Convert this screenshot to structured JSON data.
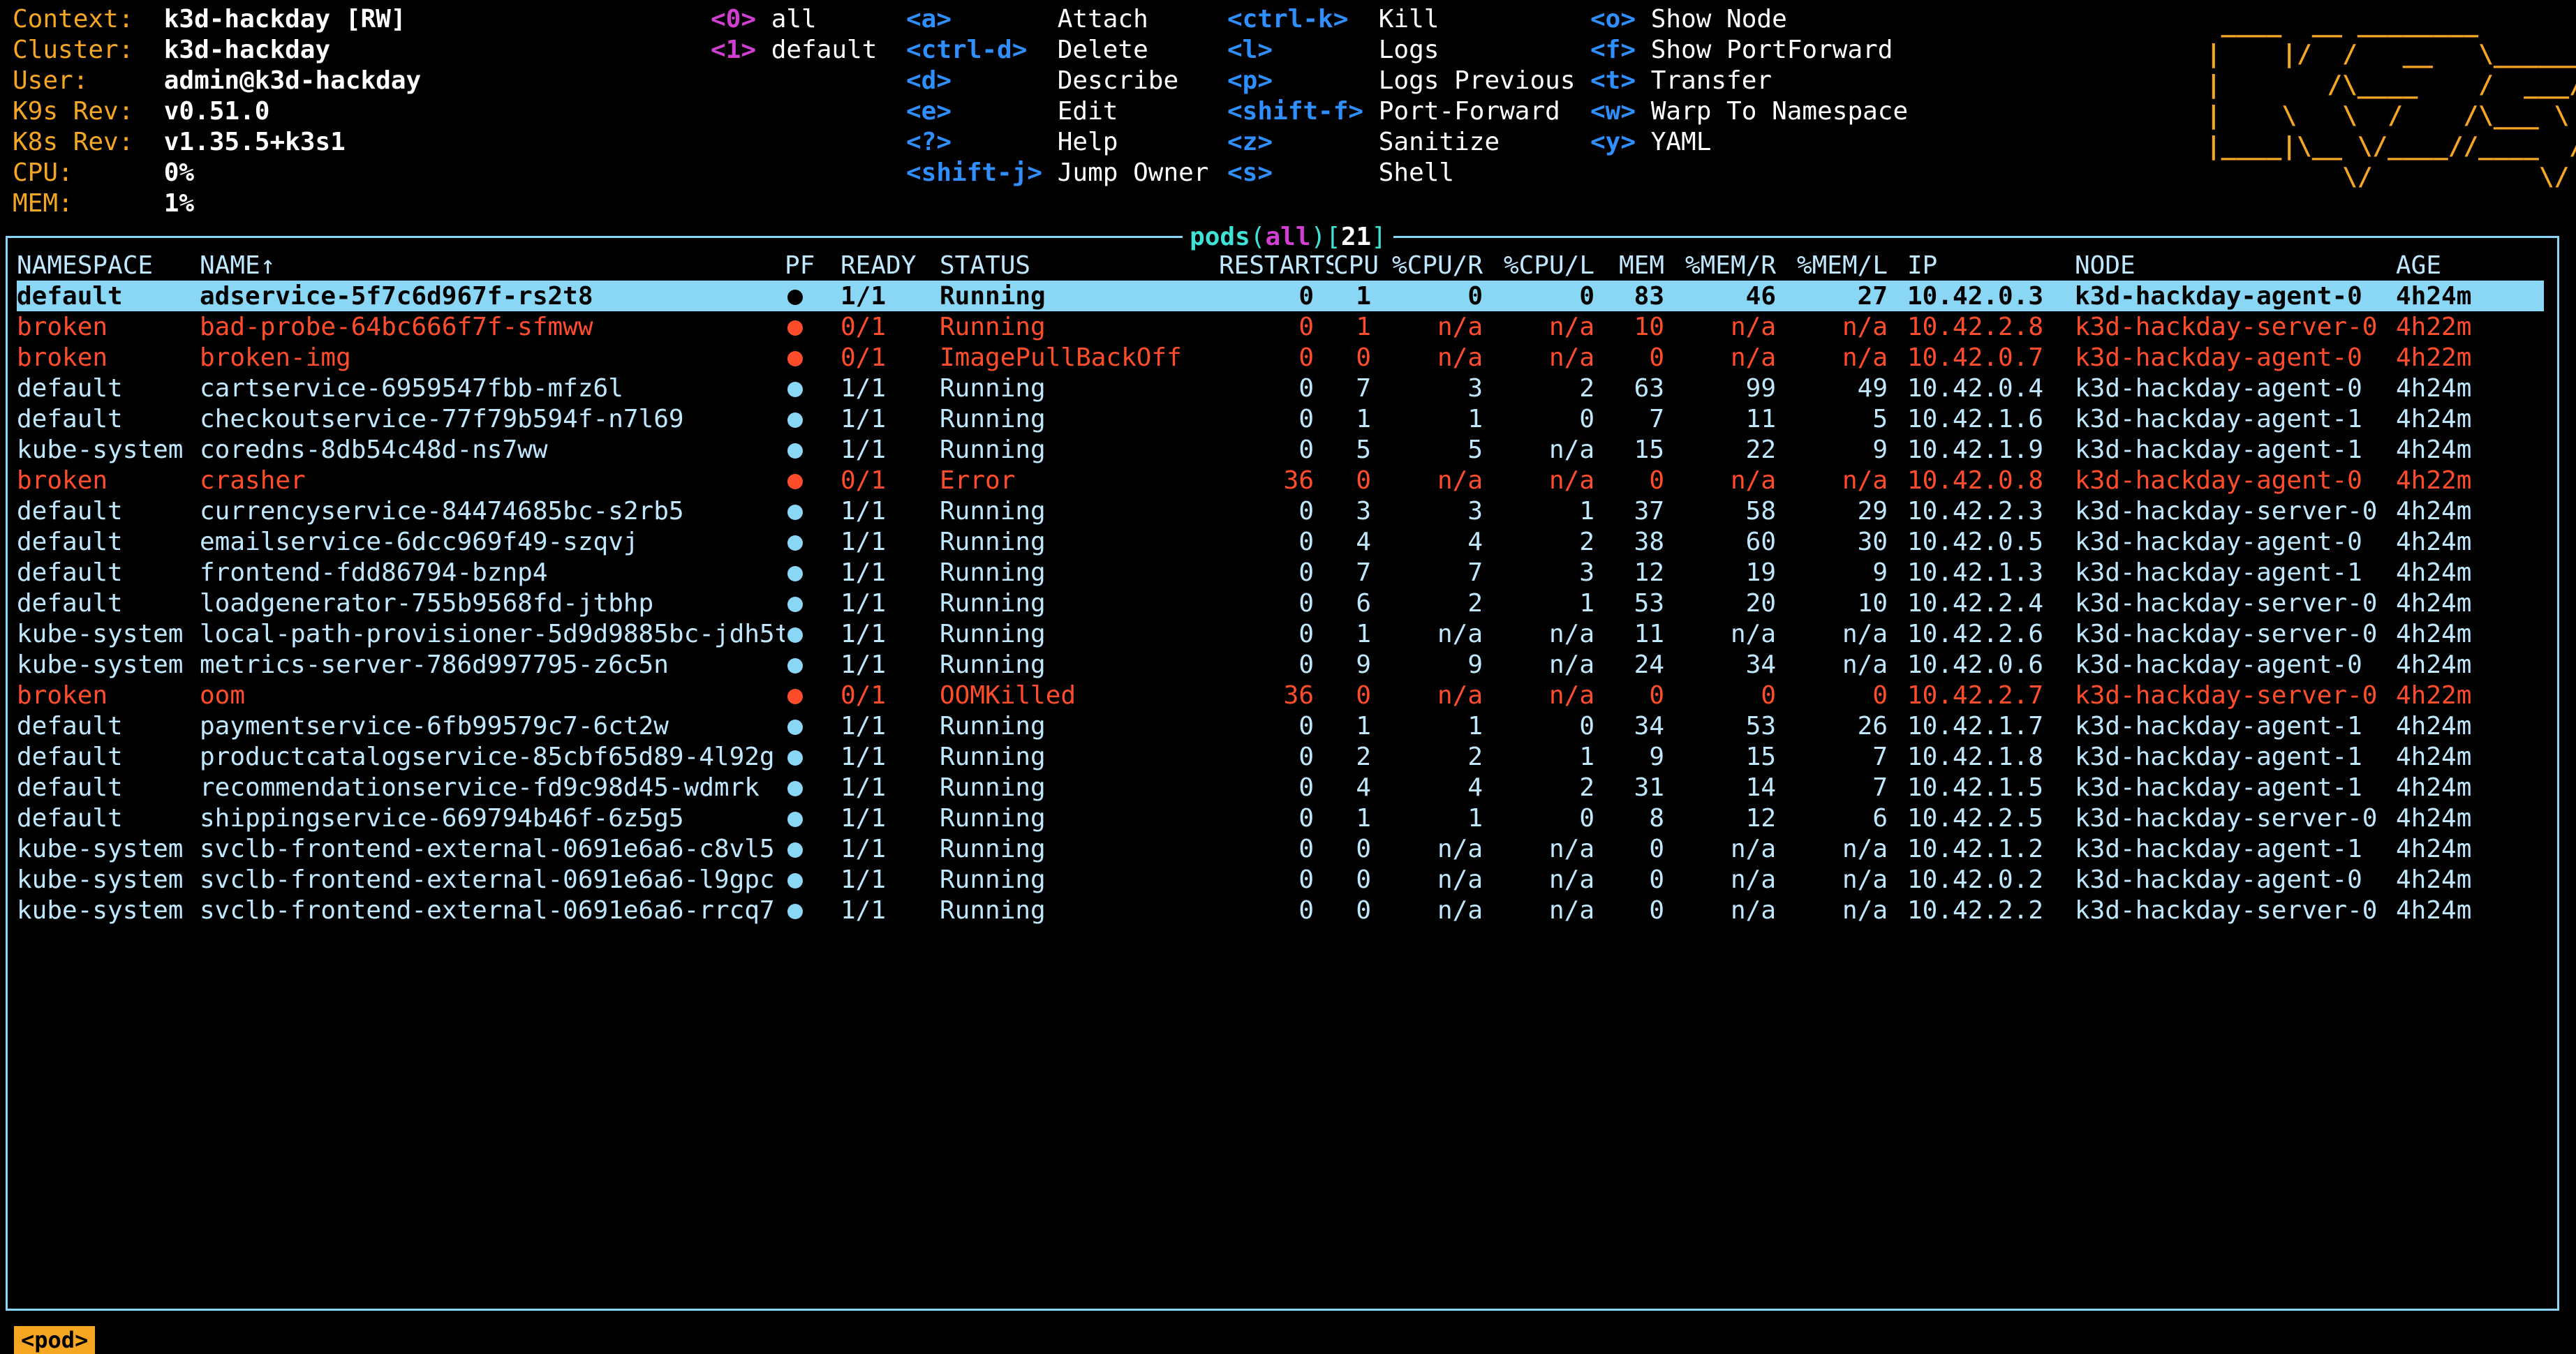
{
  "context": {
    "rows": [
      {
        "key": "Context:",
        "val": "k3d-hackday [RW]"
      },
      {
        "key": "Cluster:",
        "val": "k3d-hackday"
      },
      {
        "key": "User:",
        "val": "admin@k3d-hackday"
      },
      {
        "key": "K9s Rev:",
        "val": "v0.51.0"
      },
      {
        "key": "K8s Rev:",
        "val": "v1.35.5+k3s1"
      },
      {
        "key": "CPU:",
        "val": "0%"
      },
      {
        "key": "MEM:",
        "val": "1%"
      }
    ]
  },
  "namespaces": [
    {
      "key": "<0>",
      "val": "all"
    },
    {
      "key": "<1>",
      "val": "default"
    }
  ],
  "hotkeys": {
    "col1": [
      {
        "key": "<a>",
        "val": "Attach"
      },
      {
        "key": "<ctrl-d>",
        "val": "Delete"
      },
      {
        "key": "<d>",
        "val": "Describe"
      },
      {
        "key": "<e>",
        "val": "Edit"
      },
      {
        "key": "<?>",
        "val": "Help"
      },
      {
        "key": "<shift-j>",
        "val": "Jump Owner"
      }
    ],
    "col2": [
      {
        "key": "<ctrl-k>",
        "val": "Kill"
      },
      {
        "key": "<l>",
        "val": "Logs"
      },
      {
        "key": "<p>",
        "val": "Logs Previous"
      },
      {
        "key": "<shift-f>",
        "val": "Port-Forward"
      },
      {
        "key": "<z>",
        "val": "Sanitize"
      },
      {
        "key": "<s>",
        "val": "Shell"
      }
    ],
    "col3": [
      {
        "key": "<o>",
        "val": "Show Node"
      },
      {
        "key": "<f>",
        "val": "Show PortForward"
      },
      {
        "key": "<t>",
        "val": "Transfer"
      },
      {
        "key": "<w>",
        "val": "Warp To Namespace"
      },
      {
        "key": "<y>",
        "val": "YAML"
      }
    ]
  },
  "logo": " ____  __ ________        \n|    |/  /   __   \\______ \n|       /\\____    /  ___/ \n|    \\   \\  /    /\\___ \\  \n|____|\\__ \\/____//____  / \n         \\/           \\/  ",
  "title": {
    "resource": "pods",
    "filter": "all",
    "count": "21"
  },
  "columns": [
    "NAMESPACE",
    "NAME↑",
    "PF",
    "READY",
    "STATUS",
    "RESTARTS",
    "CPU",
    "%CPU/R",
    "%CPU/L",
    "MEM",
    "%MEM/R",
    "%MEM/L",
    "IP",
    "NODE",
    "AGE"
  ],
  "pods": [
    {
      "state": "selected",
      "ns": "default",
      "name": "adservice-5f7c6d967f-rs2t8",
      "ready": "1/1",
      "status": "Running",
      "restarts": "0",
      "cpu": "1",
      "cpur": "0",
      "cpul": "0",
      "mem": "83",
      "memr": "46",
      "meml": "27",
      "ip": "10.42.0.3",
      "node": "k3d-hackday-agent-0",
      "age": "4h24m"
    },
    {
      "state": "broken",
      "ns": "broken",
      "name": "bad-probe-64bc666f7f-sfmww",
      "ready": "0/1",
      "status": "Running",
      "restarts": "0",
      "cpu": "1",
      "cpur": "n/a",
      "cpul": "n/a",
      "mem": "10",
      "memr": "n/a",
      "meml": "n/a",
      "ip": "10.42.2.8",
      "node": "k3d-hackday-server-0",
      "age": "4h22m"
    },
    {
      "state": "broken",
      "ns": "broken",
      "name": "broken-img",
      "ready": "0/1",
      "status": "ImagePullBackOff",
      "restarts": "0",
      "cpu": "0",
      "cpur": "n/a",
      "cpul": "n/a",
      "mem": "0",
      "memr": "n/a",
      "meml": "n/a",
      "ip": "10.42.0.7",
      "node": "k3d-hackday-agent-0",
      "age": "4h22m"
    },
    {
      "state": "normal",
      "ns": "default",
      "name": "cartservice-6959547fbb-mfz6l",
      "ready": "1/1",
      "status": "Running",
      "restarts": "0",
      "cpu": "7",
      "cpur": "3",
      "cpul": "2",
      "mem": "63",
      "memr": "99",
      "meml": "49",
      "ip": "10.42.0.4",
      "node": "k3d-hackday-agent-0",
      "age": "4h24m"
    },
    {
      "state": "normal",
      "ns": "default",
      "name": "checkoutservice-77f79b594f-n7l69",
      "ready": "1/1",
      "status": "Running",
      "restarts": "0",
      "cpu": "1",
      "cpur": "1",
      "cpul": "0",
      "mem": "7",
      "memr": "11",
      "meml": "5",
      "ip": "10.42.1.6",
      "node": "k3d-hackday-agent-1",
      "age": "4h24m"
    },
    {
      "state": "normal",
      "ns": "kube-system",
      "name": "coredns-8db54c48d-ns7ww",
      "ready": "1/1",
      "status": "Running",
      "restarts": "0",
      "cpu": "5",
      "cpur": "5",
      "cpul": "n/a",
      "mem": "15",
      "memr": "22",
      "meml": "9",
      "ip": "10.42.1.9",
      "node": "k3d-hackday-agent-1",
      "age": "4h24m"
    },
    {
      "state": "broken",
      "ns": "broken",
      "name": "crasher",
      "ready": "0/1",
      "status": "Error",
      "restarts": "36",
      "cpu": "0",
      "cpur": "n/a",
      "cpul": "n/a",
      "mem": "0",
      "memr": "n/a",
      "meml": "n/a",
      "ip": "10.42.0.8",
      "node": "k3d-hackday-agent-0",
      "age": "4h22m"
    },
    {
      "state": "normal",
      "ns": "default",
      "name": "currencyservice-84474685bc-s2rb5",
      "ready": "1/1",
      "status": "Running",
      "restarts": "0",
      "cpu": "3",
      "cpur": "3",
      "cpul": "1",
      "mem": "37",
      "memr": "58",
      "meml": "29",
      "ip": "10.42.2.3",
      "node": "k3d-hackday-server-0",
      "age": "4h24m"
    },
    {
      "state": "normal",
      "ns": "default",
      "name": "emailservice-6dcc969f49-szqvj",
      "ready": "1/1",
      "status": "Running",
      "restarts": "0",
      "cpu": "4",
      "cpur": "4",
      "cpul": "2",
      "mem": "38",
      "memr": "60",
      "meml": "30",
      "ip": "10.42.0.5",
      "node": "k3d-hackday-agent-0",
      "age": "4h24m"
    },
    {
      "state": "normal",
      "ns": "default",
      "name": "frontend-fdd86794-bznp4",
      "ready": "1/1",
      "status": "Running",
      "restarts": "0",
      "cpu": "7",
      "cpur": "7",
      "cpul": "3",
      "mem": "12",
      "memr": "19",
      "meml": "9",
      "ip": "10.42.1.3",
      "node": "k3d-hackday-agent-1",
      "age": "4h24m"
    },
    {
      "state": "normal",
      "ns": "default",
      "name": "loadgenerator-755b9568fd-jtbhp",
      "ready": "1/1",
      "status": "Running",
      "restarts": "0",
      "cpu": "6",
      "cpur": "2",
      "cpul": "1",
      "mem": "53",
      "memr": "20",
      "meml": "10",
      "ip": "10.42.2.4",
      "node": "k3d-hackday-server-0",
      "age": "4h24m"
    },
    {
      "state": "normal",
      "ns": "kube-system",
      "name": "local-path-provisioner-5d9d9885bc-jdh5t",
      "ready": "1/1",
      "status": "Running",
      "restarts": "0",
      "cpu": "1",
      "cpur": "n/a",
      "cpul": "n/a",
      "mem": "11",
      "memr": "n/a",
      "meml": "n/a",
      "ip": "10.42.2.6",
      "node": "k3d-hackday-server-0",
      "age": "4h24m"
    },
    {
      "state": "normal",
      "ns": "kube-system",
      "name": "metrics-server-786d997795-z6c5n",
      "ready": "1/1",
      "status": "Running",
      "restarts": "0",
      "cpu": "9",
      "cpur": "9",
      "cpul": "n/a",
      "mem": "24",
      "memr": "34",
      "meml": "n/a",
      "ip": "10.42.0.6",
      "node": "k3d-hackday-agent-0",
      "age": "4h24m"
    },
    {
      "state": "broken",
      "ns": "broken",
      "name": "oom",
      "ready": "0/1",
      "status": "OOMKilled",
      "restarts": "36",
      "cpu": "0",
      "cpur": "n/a",
      "cpul": "n/a",
      "mem": "0",
      "memr": "0",
      "meml": "0",
      "ip": "10.42.2.7",
      "node": "k3d-hackday-server-0",
      "age": "4h22m"
    },
    {
      "state": "normal",
      "ns": "default",
      "name": "paymentservice-6fb99579c7-6ct2w",
      "ready": "1/1",
      "status": "Running",
      "restarts": "0",
      "cpu": "1",
      "cpur": "1",
      "cpul": "0",
      "mem": "34",
      "memr": "53",
      "meml": "26",
      "ip": "10.42.1.7",
      "node": "k3d-hackday-agent-1",
      "age": "4h24m"
    },
    {
      "state": "normal",
      "ns": "default",
      "name": "productcatalogservice-85cbf65d89-4l92g",
      "ready": "1/1",
      "status": "Running",
      "restarts": "0",
      "cpu": "2",
      "cpur": "2",
      "cpul": "1",
      "mem": "9",
      "memr": "15",
      "meml": "7",
      "ip": "10.42.1.8",
      "node": "k3d-hackday-agent-1",
      "age": "4h24m"
    },
    {
      "state": "normal",
      "ns": "default",
      "name": "recommendationservice-fd9c98d45-wdmrk",
      "ready": "1/1",
      "status": "Running",
      "restarts": "0",
      "cpu": "4",
      "cpur": "4",
      "cpul": "2",
      "mem": "31",
      "memr": "14",
      "meml": "7",
      "ip": "10.42.1.5",
      "node": "k3d-hackday-agent-1",
      "age": "4h24m"
    },
    {
      "state": "normal",
      "ns": "default",
      "name": "shippingservice-669794b46f-6z5g5",
      "ready": "1/1",
      "status": "Running",
      "restarts": "0",
      "cpu": "1",
      "cpur": "1",
      "cpul": "0",
      "mem": "8",
      "memr": "12",
      "meml": "6",
      "ip": "10.42.2.5",
      "node": "k3d-hackday-server-0",
      "age": "4h24m"
    },
    {
      "state": "normal",
      "ns": "kube-system",
      "name": "svclb-frontend-external-0691e6a6-c8vl5",
      "ready": "1/1",
      "status": "Running",
      "restarts": "0",
      "cpu": "0",
      "cpur": "n/a",
      "cpul": "n/a",
      "mem": "0",
      "memr": "n/a",
      "meml": "n/a",
      "ip": "10.42.1.2",
      "node": "k3d-hackday-agent-1",
      "age": "4h24m"
    },
    {
      "state": "normal",
      "ns": "kube-system",
      "name": "svclb-frontend-external-0691e6a6-l9gpc",
      "ready": "1/1",
      "status": "Running",
      "restarts": "0",
      "cpu": "0",
      "cpur": "n/a",
      "cpul": "n/a",
      "mem": "0",
      "memr": "n/a",
      "meml": "n/a",
      "ip": "10.42.0.2",
      "node": "k3d-hackday-agent-0",
      "age": "4h24m"
    },
    {
      "state": "normal",
      "ns": "kube-system",
      "name": "svclb-frontend-external-0691e6a6-rrcq7",
      "ready": "1/1",
      "status": "Running",
      "restarts": "0",
      "cpu": "0",
      "cpur": "n/a",
      "cpul": "n/a",
      "mem": "0",
      "memr": "n/a",
      "meml": "n/a",
      "ip": "10.42.2.2",
      "node": "k3d-hackday-server-0",
      "age": "4h24m"
    }
  ],
  "breadcrumb": "<pod>",
  "colors": {
    "accent": "#f5a623",
    "frame": "#8ad7f5",
    "broken": "#ff4d2b",
    "hotkey": "#2f8fff",
    "namespace_key": "#d13fd1"
  }
}
